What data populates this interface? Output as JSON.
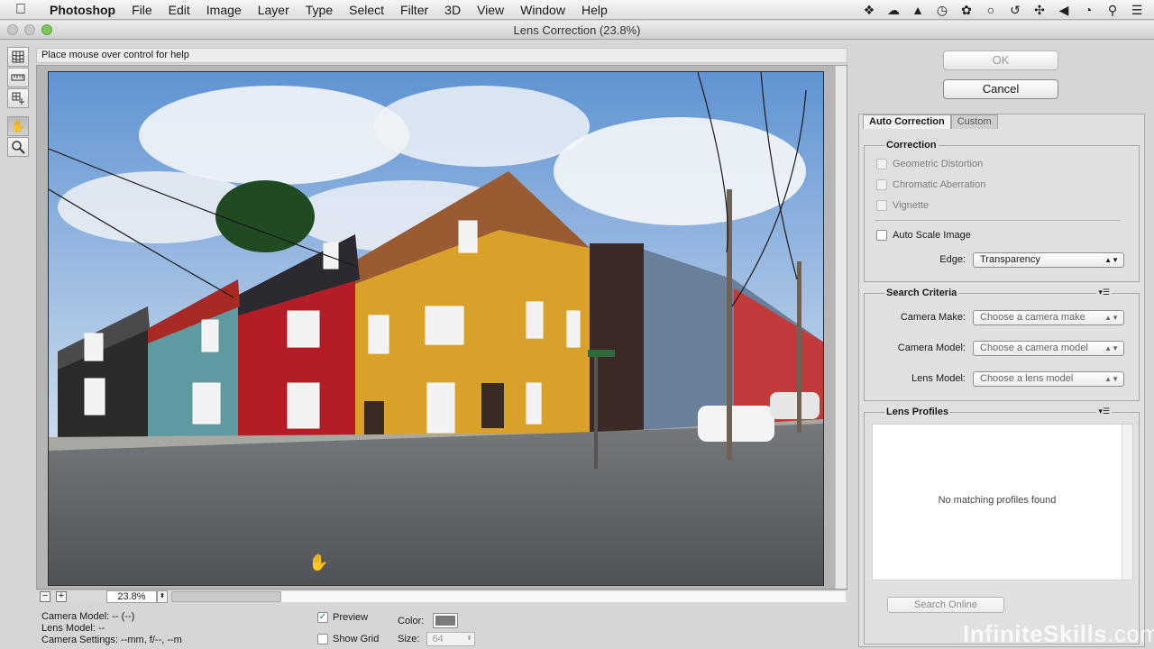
{
  "menubar": {
    "app": "Photoshop",
    "items": [
      "File",
      "Edit",
      "Image",
      "Layer",
      "Type",
      "Select",
      "Filter",
      "3D",
      "View",
      "Window",
      "Help"
    ],
    "tray_icons": [
      "dropbox-icon",
      "creative-cloud-icon",
      "notification-icon",
      "clock-icon",
      "paw-icon",
      "chat-icon",
      "time-machine-icon",
      "bluetooth-icon",
      "volume-icon",
      "timer-icon",
      "spotlight-icon",
      "list-icon"
    ]
  },
  "window": {
    "title": "Lens Correction (23.8%)"
  },
  "help_text": "Place mouse over control for help",
  "tools": [
    "remove-distortion-tool",
    "straighten-tool",
    "move-grid-tool",
    "hand-tool",
    "zoom-tool"
  ],
  "zoom": {
    "value": "23.8%",
    "minus": "−",
    "plus": "+"
  },
  "info": {
    "camera_model": "Camera Model: -- (--)",
    "lens_model": "Lens Model: --",
    "camera_settings": "Camera Settings: --mm, f/--, --m"
  },
  "options": {
    "preview": {
      "label": "Preview",
      "checked": true
    },
    "show_grid": {
      "label": "Show Grid",
      "checked": false
    },
    "color_label": "Color:",
    "grid_color": "#7a7a7a",
    "size_label": "Size:",
    "size_value": "64"
  },
  "buttons": {
    "ok": "OK",
    "cancel": "Cancel"
  },
  "tabs": [
    {
      "label": "Auto Correction",
      "active": true
    },
    {
      "label": "Custom",
      "active": false
    }
  ],
  "correction": {
    "title": "Correction",
    "items": [
      {
        "label": "Geometric Distortion",
        "enabled": false
      },
      {
        "label": "Chromatic Aberration",
        "enabled": false
      },
      {
        "label": "Vignette",
        "enabled": false
      }
    ],
    "auto_scale": "Auto Scale Image",
    "edge_label": "Edge:",
    "edge_value": "Transparency"
  },
  "search": {
    "title": "Search Criteria",
    "camera_make_label": "Camera Make:",
    "camera_make_value": "Choose a camera make",
    "camera_model_label": "Camera Model:",
    "camera_model_value": "Choose a camera model",
    "lens_model_label": "Lens Model:",
    "lens_model_value": "Choose a lens model"
  },
  "profiles": {
    "title": "Lens Profiles",
    "empty_message": "No matching profiles found",
    "search_online": "Search Online"
  },
  "watermark": {
    "brand": "InfiniteSkills",
    "suffix": ".com"
  },
  "colors": {
    "sky": "#6f9fd6",
    "street": "#5f6366",
    "house_yellow": "#d9a12a",
    "house_red": "#b41c26",
    "house_teal": "#5e9aa0"
  }
}
